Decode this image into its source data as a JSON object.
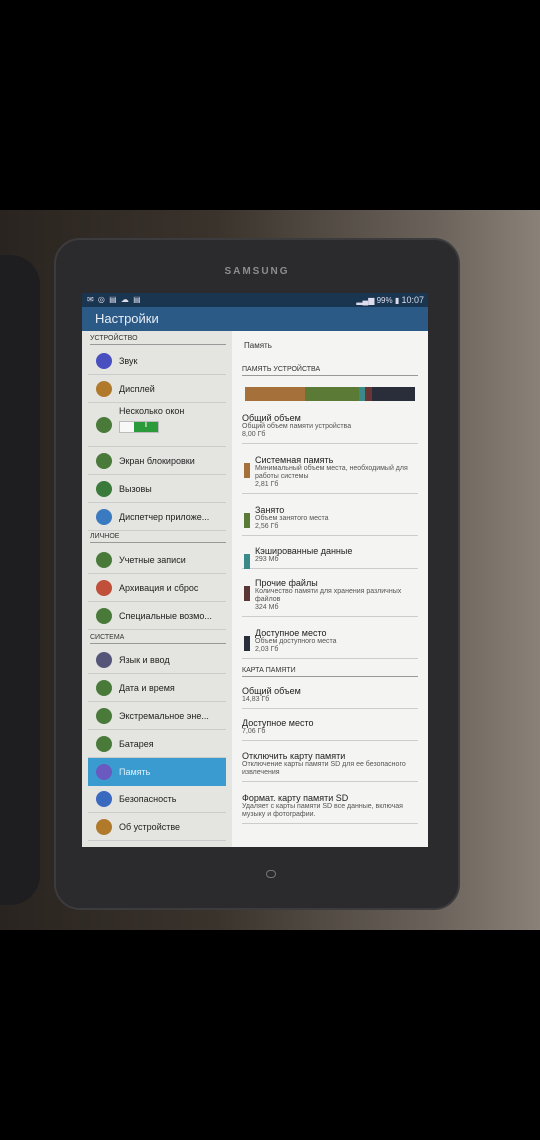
{
  "device": {
    "brand": "SAMSUNG"
  },
  "status_bar": {
    "notification_icons": "✉ ◎ ▤ ☁ ▤",
    "signal": "signal-icon",
    "battery": "99%",
    "time": "10:07"
  },
  "header": {
    "title": "Настройки"
  },
  "sidebar": {
    "sections": [
      {
        "label": "УСТРОЙСТВО",
        "items": [
          {
            "label": "Звук",
            "icon": "volume-icon",
            "color": "#4a4fc0"
          },
          {
            "label": "Дисплей",
            "icon": "display-icon",
            "color": "#b07a2a"
          },
          {
            "label": "Несколько окон",
            "icon": "multi-window-icon",
            "color": "#4a7a3a",
            "toggle": true,
            "toggle_text": "I"
          },
          {
            "label": "Экран блокировки",
            "icon": "lock-screen-icon",
            "color": "#4a7a3a"
          },
          {
            "label": "Вызовы",
            "icon": "phone-icon",
            "color": "#3a7a3a"
          },
          {
            "label": "Диспетчер приложе...",
            "icon": "apps-icon",
            "color": "#3a7ac0"
          }
        ]
      },
      {
        "label": "ЛИЧНОЕ",
        "items": [
          {
            "label": "Учетные записи",
            "icon": "key-icon",
            "color": "#4a7a3a"
          },
          {
            "label": "Архивация и сброс",
            "icon": "backup-icon",
            "color": "#c0503a"
          },
          {
            "label": "Специальные возмо...",
            "icon": "accessibility-icon",
            "color": "#4a7a3a"
          }
        ]
      },
      {
        "label": "СИСТЕМА",
        "items": [
          {
            "label": "Язык и ввод",
            "icon": "language-icon",
            "color": "#55557a"
          },
          {
            "label": "Дата и время",
            "icon": "calendar-icon",
            "color": "#4a7a3a"
          },
          {
            "label": "Экстремальное эне...",
            "icon": "power-saving-icon",
            "color": "#4a7a3a"
          },
          {
            "label": "Батарея",
            "icon": "battery-icon",
            "color": "#4a7a3a"
          },
          {
            "label": "Память",
            "icon": "storage-icon",
            "color": "#6a5ac0",
            "selected": true
          },
          {
            "label": "Безопасность",
            "icon": "security-icon",
            "color": "#3a6ac0"
          },
          {
            "label": "Об устройстве",
            "icon": "info-icon",
            "color": "#b07a2a"
          }
        ]
      }
    ]
  },
  "main": {
    "title": "Память",
    "device_storage": {
      "header": "ПАМЯТЬ УСТРОЙСТВА",
      "usage_bar": [
        {
          "key": "system",
          "value_gb": 2.81,
          "color": "#a5703a"
        },
        {
          "key": "used",
          "value_gb": 2.56,
          "color": "#5a7a35"
        },
        {
          "key": "cached",
          "value_gb": 0.293,
          "color": "#3a8a8a"
        },
        {
          "key": "misc",
          "value_gb": 0.324,
          "color": "#6a3535"
        },
        {
          "key": "available",
          "value_gb": 2.03,
          "color": "#2a2e3a"
        }
      ],
      "items": [
        {
          "title": "Общий объем",
          "desc": "Общий объем памяти устройства",
          "value": "8,00 Гб"
        },
        {
          "title": "Системная память",
          "desc": "Минимальный объем места, необходимый для работы системы",
          "value": "2,81 Гб",
          "color": "#a5703a"
        },
        {
          "title": "Занято",
          "desc": "Объем занятого места",
          "value": "2,56 Гб",
          "color": "#5a7a35"
        },
        {
          "title": "Кэшированные данные",
          "desc": "",
          "value": "293 Мб",
          "color": "#3a8a8a"
        },
        {
          "title": "Прочие файлы",
          "desc": "Количество памяти для хранения различных файлов",
          "value": "324 Мб",
          "color": "#5a3535"
        },
        {
          "title": "Доступное место",
          "desc": "Объем доступного места",
          "value": "2,03 Гб",
          "color": "#2a2e3a"
        }
      ]
    },
    "sd_card": {
      "header": "КАРТА ПАМЯТИ",
      "items": [
        {
          "title": "Общий объем",
          "desc": "",
          "value": "14,83 Гб"
        },
        {
          "title": "Доступное место",
          "desc": "",
          "value": "7,06 Гб"
        },
        {
          "title": "Отключить карту памяти",
          "desc": "Отключение карты памяти SD для ее безопасного извлечения",
          "value": ""
        },
        {
          "title": "Формат. карту памяти SD",
          "desc": "Удаляет с карты памяти SD все данные, включая музыку и фотографии.",
          "value": ""
        }
      ]
    }
  }
}
